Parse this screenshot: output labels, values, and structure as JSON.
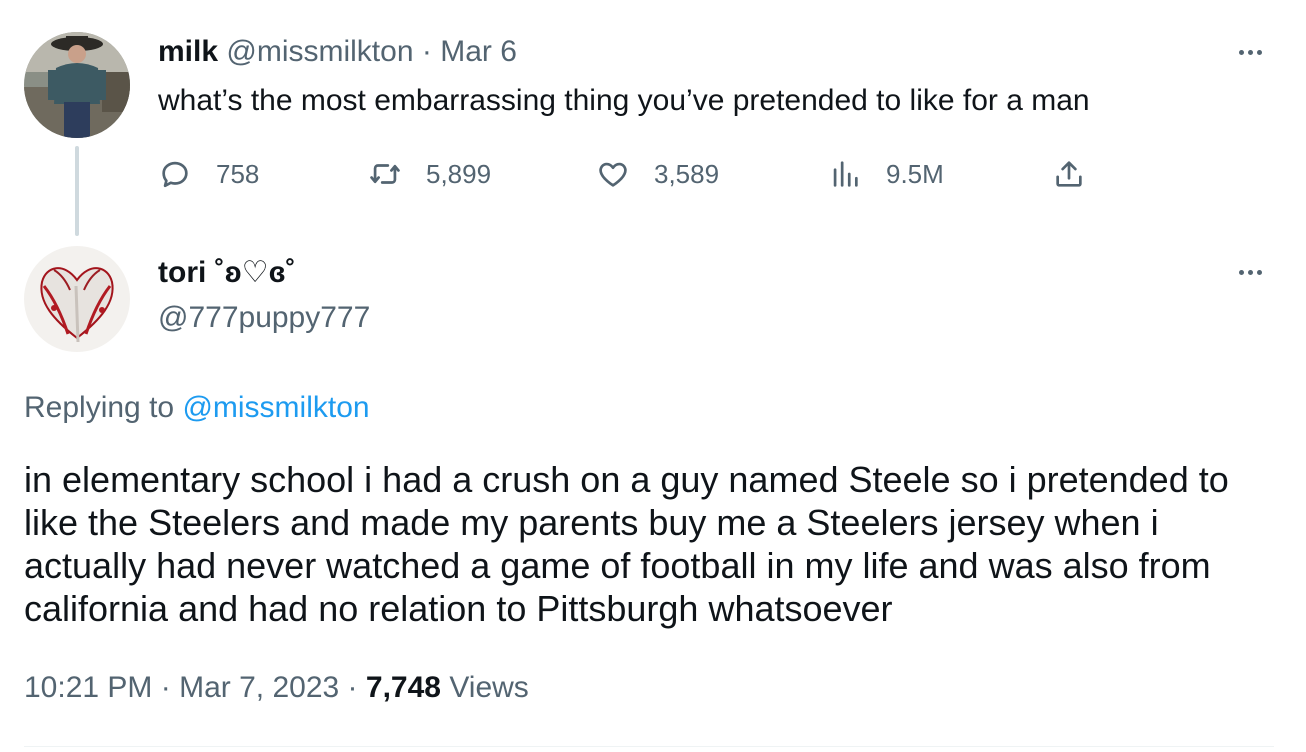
{
  "parent_tweet": {
    "author_name": "milk",
    "author_handle": "@missmilkton",
    "separator": "·",
    "date": "Mar 6",
    "text": "what’s the most embarrassing thing you’ve pretended to like for a man",
    "stats": {
      "replies": "758",
      "retweets": "5,899",
      "likes": "3,589",
      "views": "9.5M"
    }
  },
  "reply_tweet": {
    "author_name": "tori ˚ʚ♡ɞ˚",
    "author_handle": "@777puppy777",
    "replying_prefix": "Replying to",
    "replying_to": "@missmilkton",
    "text": "in elementary school i had a crush on a guy named Steele so i pretended to like the Steelers and made my parents buy me a Steelers jersey when i actually had never watched a game of football in my life and was also from california and had no relation to Pittsburgh whatsoever",
    "time": "10:21 PM",
    "separator": "·",
    "date": "Mar 7, 2023",
    "views_count": "7,748",
    "views_label": "Views"
  },
  "colors": {
    "text_primary": "#0f1419",
    "text_secondary": "#536471",
    "link": "#1d9bf0",
    "thread_line": "#cfd9de"
  },
  "icons": {
    "reply": "reply-bubble-icon",
    "retweet": "retweet-icon",
    "like": "heart-icon",
    "views": "bar-chart-icon",
    "share": "share-upload-icon",
    "more": "more-dots-icon"
  }
}
